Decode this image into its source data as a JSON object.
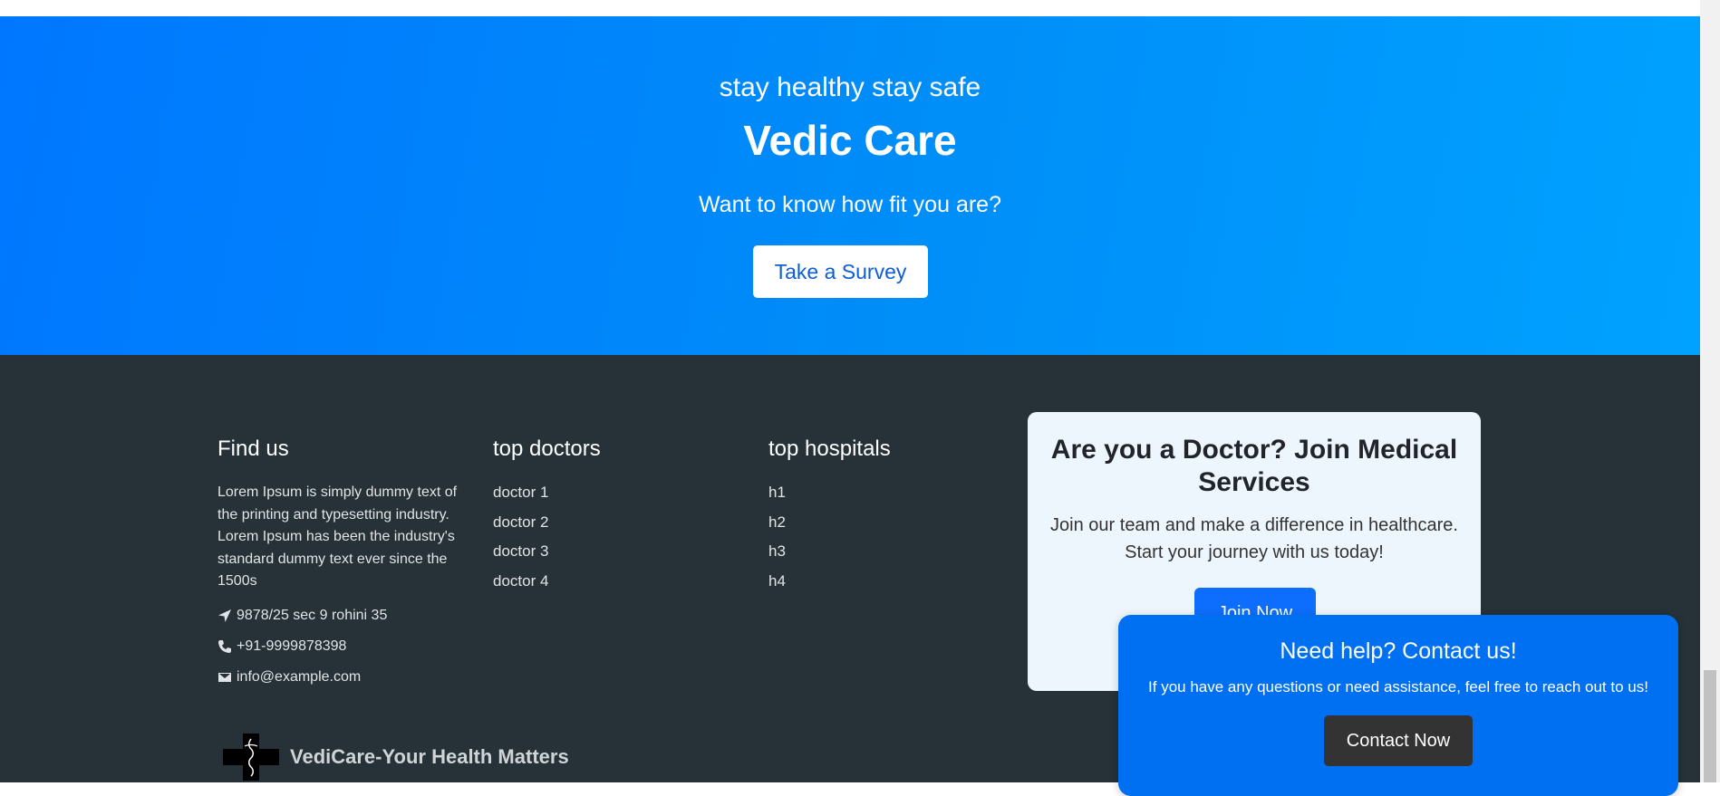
{
  "hero": {
    "tagline": "stay healthy stay safe",
    "title": "Vedic Care",
    "question": "Want to know how fit you are?",
    "survey_button": "Take a Survey"
  },
  "footer": {
    "find_us": {
      "heading": "Find us",
      "description": "Lorem Ipsum is simply dummy text of the printing and typesetting industry. Lorem Ipsum has been the industry's standard dummy text ever since the 1500s",
      "address": "9878/25 sec 9 rohini 35",
      "phone": "+91-9999878398",
      "email": "info@example.com"
    },
    "top_doctors": {
      "heading": "top doctors",
      "items": [
        "doctor 1",
        "doctor 2",
        "doctor 3",
        "doctor 4"
      ]
    },
    "top_hospitals": {
      "heading": "top hospitals",
      "items": [
        "h1",
        "h2",
        "h3",
        "h4"
      ]
    },
    "brand": "VediCare-Your Health Matters"
  },
  "doctor_card": {
    "title": "Are you a Doctor? Join Medical Services",
    "body": "Join our team and make a difference in healthcare. Start your journey with us today!",
    "button": "Join Now"
  },
  "help_popup": {
    "title": "Need help? Contact us!",
    "body": "If you have any questions or need assistance, feel free to reach out to us!",
    "button": "Contact Now"
  },
  "colors": {
    "hero_start": "#0077ff",
    "hero_end": "#00a2ff",
    "footer_bg": "#263238",
    "card_bg": "#eef6fd",
    "popup_bg": "#0070f3",
    "contact_button_bg": "#333333"
  },
  "icons": [
    "location-arrow-icon",
    "phone-icon",
    "envelope-icon",
    "medical-cross-logo"
  ]
}
